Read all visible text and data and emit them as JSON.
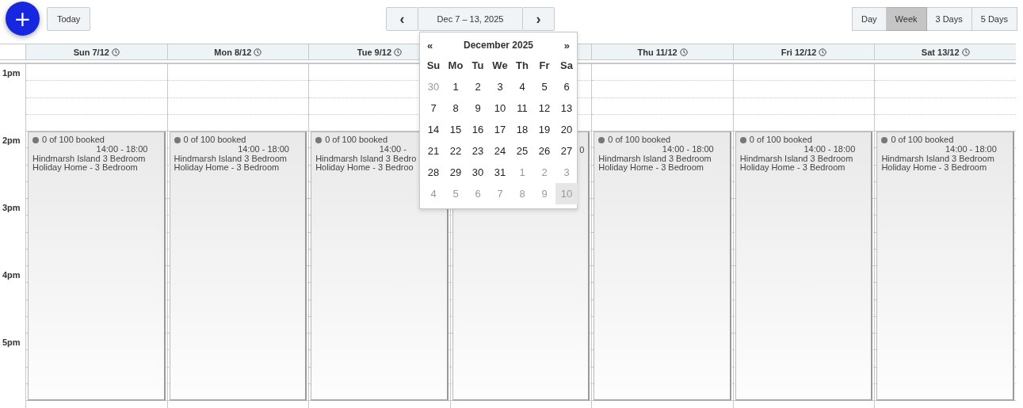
{
  "toolbar": {
    "add_label": "+",
    "today_label": "Today",
    "prev_label": "‹",
    "range_label": "Dec 7 – 13, 2025",
    "next_label": "›",
    "views": [
      {
        "label": "Day",
        "selected": false
      },
      {
        "label": "Week",
        "selected": true
      },
      {
        "label": "3 Days",
        "selected": false
      },
      {
        "label": "5 Days",
        "selected": false
      }
    ]
  },
  "days": [
    {
      "kind": "day",
      "label": "Sun 7/12"
    },
    {
      "kind": "day",
      "label": "Mon 8/12"
    },
    {
      "kind": "day",
      "label": "Tue 9/12"
    },
    {
      "kind": "covered"
    },
    {
      "kind": "day",
      "label": "Thu 11/12"
    },
    {
      "kind": "day",
      "label": "Fri 12/12"
    },
    {
      "kind": "day",
      "label": "Sat 13/12"
    }
  ],
  "hours": [
    "1pm",
    "2pm",
    "3pm",
    "4pm",
    "5pm"
  ],
  "events": [
    {
      "kind": "event",
      "status": "0 of 100 booked",
      "time": "14:00 - 18:00",
      "lines": [
        "Hindmarsh Island 3 Bedroom",
        "Holiday Home - 3 Bedroom"
      ]
    },
    {
      "kind": "event",
      "status": "0 of 100 booked",
      "time": "14:00 - 18:00",
      "lines": [
        "Hindmarsh Island 3 Bedroom",
        "Holiday Home - 3 Bedroom"
      ]
    },
    {
      "kind": "event",
      "status": "0 of 100 booked",
      "time": "14:00 -",
      "lines": [
        "Hindmarsh Island 3 Bedro",
        "Holiday Home - 3 Bedroo"
      ]
    },
    {
      "kind": "covered",
      "time": "0"
    },
    {
      "kind": "event",
      "status": "0 of 100 booked",
      "time": "14:00 - 18:00",
      "lines": [
        "Hindmarsh Island 3 Bedroom",
        "Holiday Home - 3 Bedroom"
      ]
    },
    {
      "kind": "event",
      "status": "0 of 100 booked",
      "time": "14:00 - 18:00",
      "lines": [
        "Hindmarsh Island 3 Bedroom",
        "Holiday Home - 3 Bedroom"
      ]
    },
    {
      "kind": "event",
      "status": "0 of 100 booked",
      "time": "14:00 - 18:00",
      "lines": [
        "Hindmarsh Island 3 Bedroom",
        "Holiday Home - 3 Bedroom"
      ]
    }
  ],
  "datepicker": {
    "prev_label": "«",
    "title": "December 2025",
    "next_label": "»",
    "weekdays": [
      "Su",
      "Mo",
      "Tu",
      "We",
      "Th",
      "Fr",
      "Sa"
    ],
    "weeks": [
      [
        {
          "label": "30",
          "outside": true,
          "highlighted": false
        },
        {
          "label": "1",
          "outside": false,
          "highlighted": false
        },
        {
          "label": "2",
          "outside": false,
          "highlighted": false
        },
        {
          "label": "3",
          "outside": false,
          "highlighted": false
        },
        {
          "label": "4",
          "outside": false,
          "highlighted": false
        },
        {
          "label": "5",
          "outside": false,
          "highlighted": false
        },
        {
          "label": "6",
          "outside": false,
          "highlighted": false
        }
      ],
      [
        {
          "label": "7",
          "outside": false,
          "highlighted": false
        },
        {
          "label": "8",
          "outside": false,
          "highlighted": false
        },
        {
          "label": "9",
          "outside": false,
          "highlighted": false
        },
        {
          "label": "10",
          "outside": false,
          "highlighted": false
        },
        {
          "label": "11",
          "outside": false,
          "highlighted": false
        },
        {
          "label": "12",
          "outside": false,
          "highlighted": false
        },
        {
          "label": "13",
          "outside": false,
          "highlighted": false
        }
      ],
      [
        {
          "label": "14",
          "outside": false,
          "highlighted": false
        },
        {
          "label": "15",
          "outside": false,
          "highlighted": false
        },
        {
          "label": "16",
          "outside": false,
          "highlighted": false
        },
        {
          "label": "17",
          "outside": false,
          "highlighted": false
        },
        {
          "label": "18",
          "outside": false,
          "highlighted": false
        },
        {
          "label": "19",
          "outside": false,
          "highlighted": false
        },
        {
          "label": "20",
          "outside": false,
          "highlighted": false
        }
      ],
      [
        {
          "label": "21",
          "outside": false,
          "highlighted": false
        },
        {
          "label": "22",
          "outside": false,
          "highlighted": false
        },
        {
          "label": "23",
          "outside": false,
          "highlighted": false
        },
        {
          "label": "24",
          "outside": false,
          "highlighted": false
        },
        {
          "label": "25",
          "outside": false,
          "highlighted": false
        },
        {
          "label": "26",
          "outside": false,
          "highlighted": false
        },
        {
          "label": "27",
          "outside": false,
          "highlighted": false
        }
      ],
      [
        {
          "label": "28",
          "outside": false,
          "highlighted": false
        },
        {
          "label": "29",
          "outside": false,
          "highlighted": false
        },
        {
          "label": "30",
          "outside": false,
          "highlighted": false
        },
        {
          "label": "31",
          "outside": false,
          "highlighted": false
        },
        {
          "label": "1",
          "outside": true,
          "highlighted": false
        },
        {
          "label": "2",
          "outside": true,
          "highlighted": false
        },
        {
          "label": "3",
          "outside": true,
          "highlighted": false
        }
      ],
      [
        {
          "label": "4",
          "outside": true,
          "highlighted": false
        },
        {
          "label": "5",
          "outside": true,
          "highlighted": false
        },
        {
          "label": "6",
          "outside": true,
          "highlighted": false
        },
        {
          "label": "7",
          "outside": true,
          "highlighted": false
        },
        {
          "label": "8",
          "outside": true,
          "highlighted": false
        },
        {
          "label": "9",
          "outside": true,
          "highlighted": false
        },
        {
          "label": "10",
          "outside": true,
          "highlighted": true
        }
      ]
    ]
  }
}
